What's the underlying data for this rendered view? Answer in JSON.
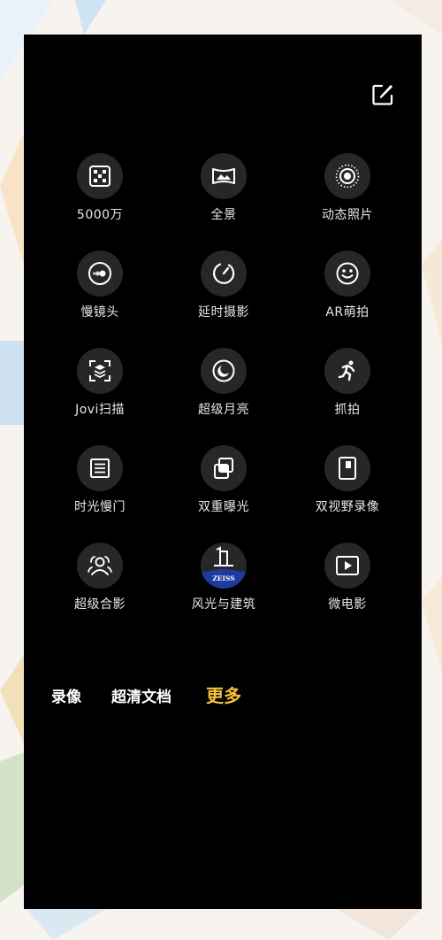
{
  "header": {
    "edit_icon": "edit-icon"
  },
  "modes": [
    {
      "id": "50mp",
      "label": "5000万",
      "icon": "dice-icon"
    },
    {
      "id": "panorama",
      "label": "全景",
      "icon": "panorama-icon"
    },
    {
      "id": "live-photo",
      "label": "动态照片",
      "icon": "live-photo-icon"
    },
    {
      "id": "slow-motion",
      "label": "慢镜头",
      "icon": "slow-motion-icon"
    },
    {
      "id": "timelapse",
      "label": "延时摄影",
      "icon": "timelapse-icon"
    },
    {
      "id": "ar-cute",
      "label": "AR萌拍",
      "icon": "smile-icon"
    },
    {
      "id": "jovi-scan",
      "label": "Jovi扫描",
      "icon": "scan-icon"
    },
    {
      "id": "super-moon",
      "label": "超级月亮",
      "icon": "moon-icon"
    },
    {
      "id": "snapshot",
      "label": "抓拍",
      "icon": "running-icon"
    },
    {
      "id": "light-shutter",
      "label": "时光慢门",
      "icon": "shutter-icon"
    },
    {
      "id": "double-exposure",
      "label": "双重曝光",
      "icon": "double-exposure-icon"
    },
    {
      "id": "dual-view",
      "label": "双视野录像",
      "icon": "dual-view-icon"
    },
    {
      "id": "group-photo",
      "label": "超级合影",
      "icon": "group-icon"
    },
    {
      "id": "landscape-architecture",
      "label": "风光与建筑",
      "icon": "zeiss-building-icon",
      "badge": "ZEISS"
    },
    {
      "id": "micro-film",
      "label": "微电影",
      "icon": "play-icon"
    }
  ],
  "tabs": [
    {
      "label": "录像"
    },
    {
      "label": "超清文档"
    },
    {
      "label": "更多",
      "active": true
    }
  ],
  "colors": {
    "accent": "#f5c13d",
    "circle": "#272727",
    "zeiss_blue": "#1f3a9e"
  }
}
